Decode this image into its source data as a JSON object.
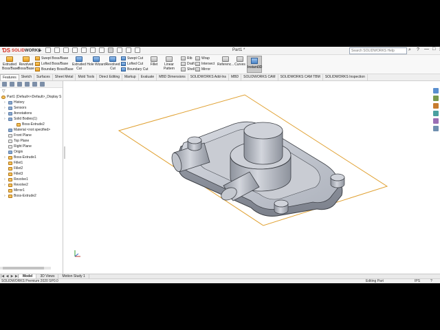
{
  "app": {
    "logo_text_a": "SOLID",
    "logo_text_b": "WORKS",
    "document_title": "Part1 *",
    "search_placeholder": "Search SOLIDWORKS Help",
    "window_controls": [
      "—",
      "□",
      "✕"
    ]
  },
  "ribbon": {
    "extruded_boss": "Extruded\nBoss/Base",
    "revolved_boss": "Revolved\nBoss/Base",
    "swept_boss": "Swept Boss/Base",
    "lofted_boss": "Lofted Boss/Base",
    "boundary_boss": "Boundary Boss/Base",
    "extruded_cut": "Extruded\nCut",
    "hole_wizard": "Hole Wizard",
    "revolved_cut": "Revolved\nCut",
    "swept_cut": "Swept Cut",
    "lofted_cut": "Lofted Cut",
    "boundary_cut": "Boundary Cut",
    "fillet": "Fillet",
    "linear_pattern": "Linear Pattern",
    "rib": "Rib",
    "draft": "Draft",
    "shell": "Shell",
    "wrap": "Wrap",
    "intersect": "Intersect",
    "mirror": "Mirror",
    "reference": "Referenc...",
    "curves": "Curves",
    "instant3d": "Instant3D"
  },
  "command_tabs": [
    "Features",
    "Sketch",
    "Surfaces",
    "Sheet Metal",
    "Mold Tools",
    "Direct Editing",
    "Markup",
    "Evaluate",
    "MBD Dimensions",
    "SOLIDWORKS Add-Ins",
    "MBD",
    "SOLIDWORKS CAM",
    "SOLIDWORKS CAM TBM",
    "SOLIDWORKS Inspection"
  ],
  "feature_tree": {
    "root": "Part1  (Default<<Default>_Display S",
    "items": [
      {
        "label": "History",
        "kind": "folder"
      },
      {
        "label": "Sensors",
        "kind": "folder"
      },
      {
        "label": "Annotations",
        "kind": "folder"
      },
      {
        "label": "Solid Bodies(1)",
        "kind": "folder"
      },
      {
        "label": "Boss-Extrude2",
        "kind": "feat"
      },
      {
        "label": "Material <not specified>",
        "kind": "folder"
      },
      {
        "label": "Front Plane",
        "kind": "plane"
      },
      {
        "label": "Top Plane",
        "kind": "plane"
      },
      {
        "label": "Right Plane",
        "kind": "plane"
      },
      {
        "label": "Origin",
        "kind": "folder"
      },
      {
        "label": "Boss-Extrude1",
        "kind": "feat"
      },
      {
        "label": "Fillet1",
        "kind": "feat"
      },
      {
        "label": "Fillet2",
        "kind": "feat"
      },
      {
        "label": "Fillet3",
        "kind": "feat"
      },
      {
        "label": "Revolve1",
        "kind": "feat"
      },
      {
        "label": "Revolve2",
        "kind": "feat"
      },
      {
        "label": "Mirror1",
        "kind": "feat"
      },
      {
        "label": "Boss-Extrude2",
        "kind": "feat"
      }
    ]
  },
  "bottom_tabs": [
    "Model",
    "3D Views",
    "Motion Study 1"
  ],
  "status": {
    "product": "SOLIDWORKS Premium 2020 SP0.0",
    "mode": "Editing Part",
    "units": "IPS",
    "help": "?"
  },
  "colors": {
    "plane_outline": "#e0a030",
    "part_fill": "#b9bdc6",
    "accent": "#d52b1e"
  }
}
